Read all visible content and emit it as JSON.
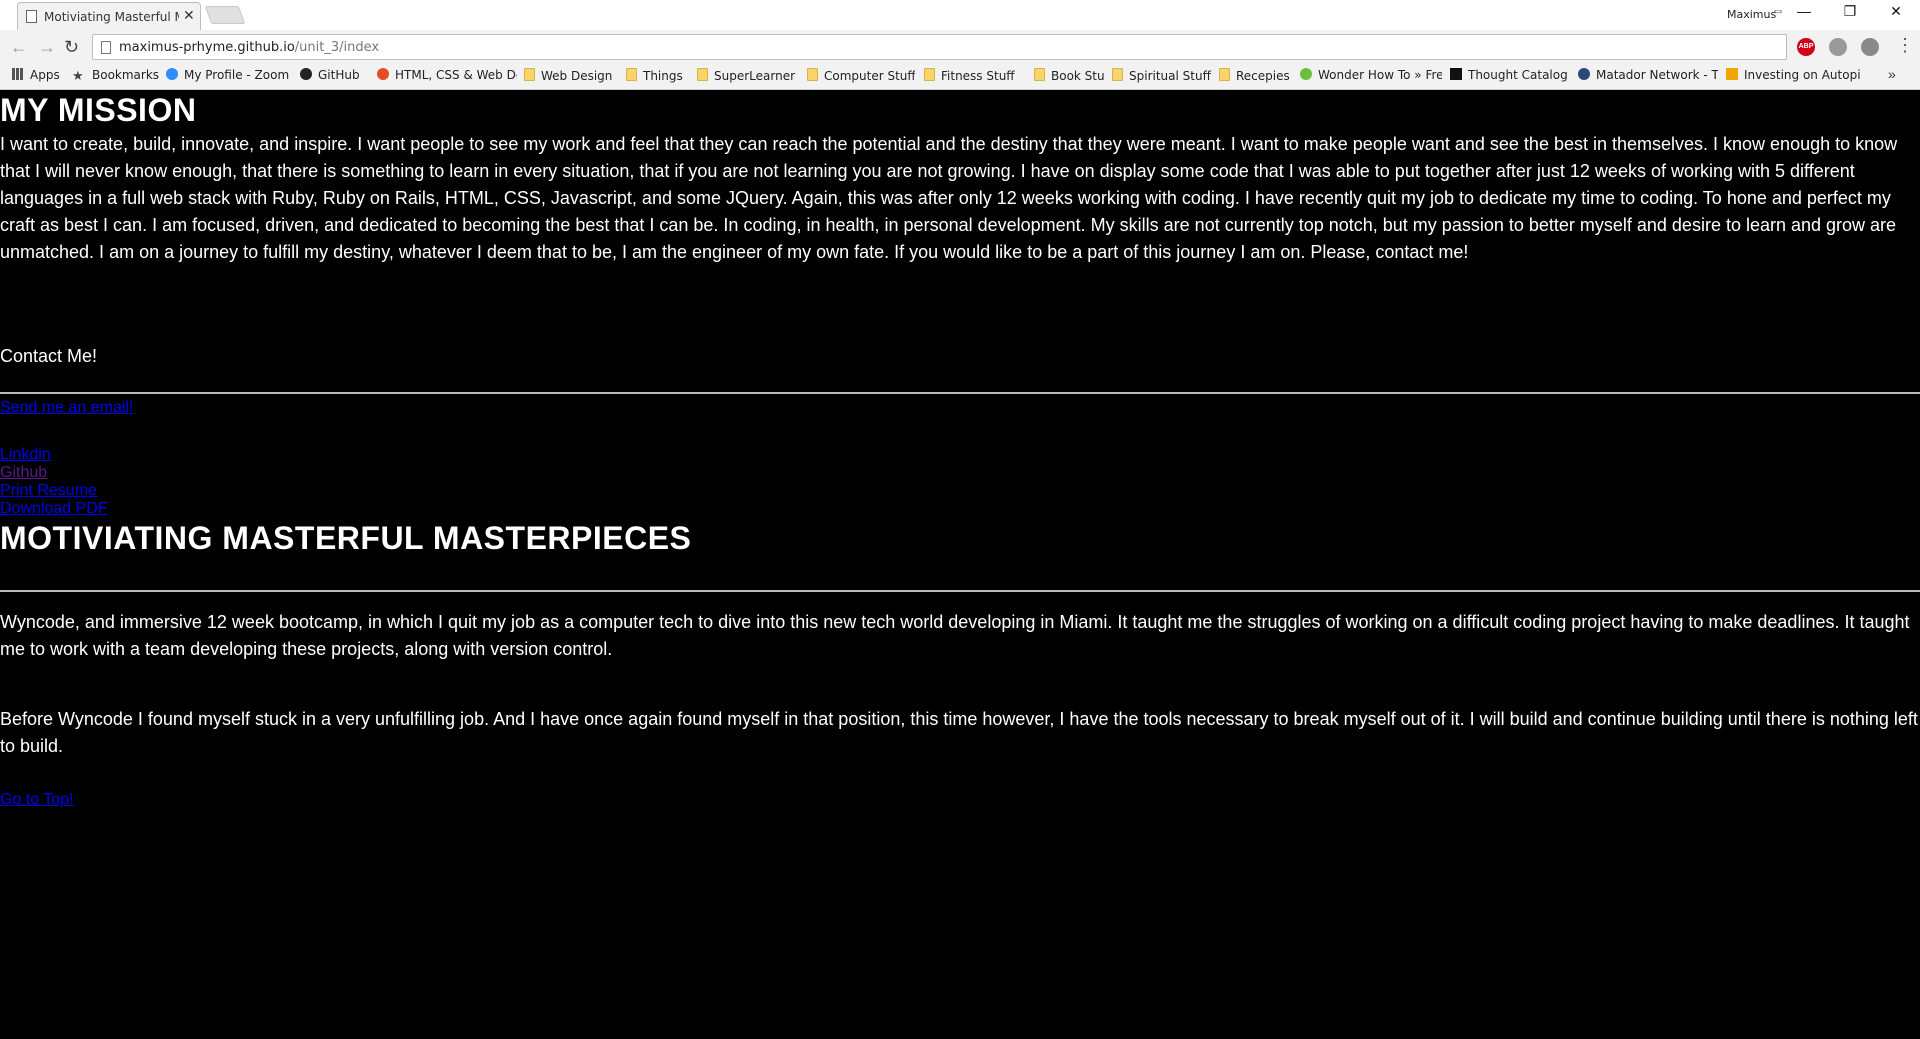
{
  "browser": {
    "tab_title": "Motiviating Masterful Ma",
    "profile_name": "Maximus",
    "url_host": "maximus-prhyme.github.io",
    "url_path": "/unit_3/index",
    "bookmarks": [
      {
        "label": "Apps",
        "icon": "apps-grid-icon"
      },
      {
        "label": "Bookmarks",
        "icon": "star-icon"
      },
      {
        "label": "My Profile - Zoom",
        "icon": "zoom-icon"
      },
      {
        "label": "GitHub",
        "icon": "github-icon"
      },
      {
        "label": "HTML, CSS & Web De",
        "icon": "html-icon"
      },
      {
        "label": "Web Design",
        "icon": "folder-icon"
      },
      {
        "label": "Things",
        "icon": "folder-icon"
      },
      {
        "label": "SuperLearner",
        "icon": "folder-icon"
      },
      {
        "label": "Computer Stuff",
        "icon": "folder-icon"
      },
      {
        "label": "Fitness Stuff",
        "icon": "folder-icon"
      },
      {
        "label": "Book Stuff",
        "icon": "folder-icon"
      },
      {
        "label": "Spiritual Stuff",
        "icon": "folder-icon"
      },
      {
        "label": "Recepies",
        "icon": "folder-icon"
      },
      {
        "label": "Wonder How To » Fre",
        "icon": "wonderhowto-icon"
      },
      {
        "label": "Thought Catalog",
        "icon": "thought-catalog-icon"
      },
      {
        "label": "Matador Network - T",
        "icon": "matador-icon"
      },
      {
        "label": "Investing on Autopilo",
        "icon": "investing-icon"
      }
    ],
    "extensions": [
      {
        "name": "adblock-plus-icon",
        "label": "ABP",
        "color": "#d0021b"
      },
      {
        "name": "extension-gray-icon",
        "label": "",
        "color": "#9a9a9a"
      },
      {
        "name": "extension-puzzle-icon",
        "label": "",
        "color": "#8a8a8a"
      }
    ]
  },
  "page": {
    "mission_title": "MY MISSION",
    "mission_text": "I want to create, build, innovate, and inspire. I want people to see my work and feel that they can reach the potential and the destiny that they were meant. I want to make people want and see the best in themselves. I know enough to know that I will never know enough, that there is something to learn in every situation, that if you are not learning you are not growing. I have on display some code that I was able to put together after just 12 weeks of working with 5 different languages in a full web stack with Ruby, Ruby on Rails, HTML, CSS, Javascript, and some JQuery. Again, this was after only 12 weeks working with coding. I have recently quit my job to dedicate my time to coding. To hone and perfect my craft as best I can. I am focused, driven, and dedicated to becoming the best that I can be. In coding, in health, in personal development. My skills are not currently top notch, but my passion to better myself and desire to learn and grow are unmatched. I am on a journey to fulfill my destiny, whatever I deem that to be, I am the engineer of my own fate. If you would like to be a part of this journey I am on. Please, contact me!",
    "contact_heading": "Contact Me!",
    "email_link": "Send me an email!",
    "links": [
      "Linkdin",
      "Github",
      "Print Resume",
      "Download PDF"
    ],
    "masterpieces_title": "MOTIVIATING MASTERFUL MASTERPIECES",
    "wyncode_text": "Wyncode, and immersive 12 week bootcamp, in which I quit my job as a computer tech to dive into this new tech world developing in Miami. It taught me the struggles of working on a difficult coding project having to make deadlines. It taught me to work with a team developing these projects, along with version control.",
    "before_text": "Before Wyncode I found myself stuck in a very unfulfilling job. And I have once again found myself in that position, this time however, I have the tools necessary to break myself out of it. I will build and continue building until there is nothing left to build.",
    "top_link": "Go to Top!"
  },
  "colors": {
    "link": "#0000ee",
    "visited_link": "#551a8b",
    "page_bg": "#000000",
    "text": "#ffffff"
  }
}
